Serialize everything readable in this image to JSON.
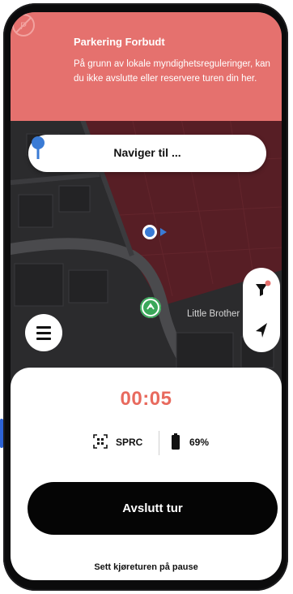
{
  "banner": {
    "title": "Parkering Forbudt",
    "message": "På grunn av lokale myndighetsreguleringer, kan du ikke avslutte eller reservere turen din her.",
    "icon": "no-parking-icon"
  },
  "search": {
    "label": "Naviger til ...",
    "icon": "location-pin-icon"
  },
  "map": {
    "place_label": "Little Brother",
    "restricted_zone_color": "#5a1e25"
  },
  "trip": {
    "timer": "00:05",
    "vehicle_code": "SPRC",
    "battery": "69%",
    "end_button_label": "Avslutt tur",
    "pause_label": "Sett kjøreturen på pause"
  },
  "colors": {
    "banner": "#e5716e",
    "timer": "#e86a5e",
    "accent_blue": "#3a7bd5",
    "scooter_green": "#3aa85a"
  }
}
